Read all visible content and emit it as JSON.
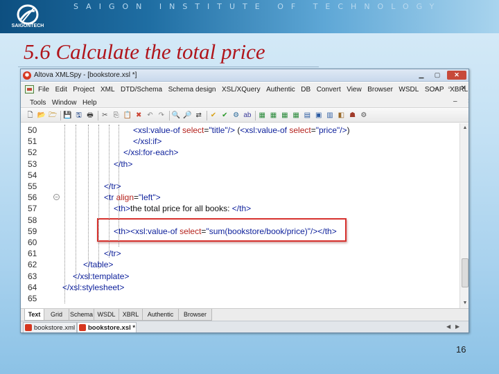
{
  "slide": {
    "institute": "SAIGON INSTITUTE OF TECHNOLOGY",
    "logo_text": "SAIGONTECH",
    "title": "5.6 Calculate the total price",
    "page_number": "16"
  },
  "window": {
    "title": "Altova XMLSpy - [bookstore.xsl *]",
    "min_icon": "▁",
    "max_icon": "▢",
    "close_icon": "✕"
  },
  "menu": {
    "row1": [
      "File",
      "Edit",
      "Project",
      "XML",
      "DTD/Schema",
      "Schema design",
      "XSL/XQuery",
      "Authentic",
      "DB",
      "Convert",
      "View",
      "Browser",
      "WSDL",
      "SOAP",
      "XBRL"
    ],
    "row2": [
      "Tools",
      "Window",
      "Help"
    ],
    "doc_controls": "–  ▫  ✕",
    "doc_controls2": "–  ✕"
  },
  "toolbar": {
    "buttons": [
      "new-icon",
      "open-icon",
      "open-folder-icon",
      "save-icon",
      "save-all-icon",
      "print-icon",
      "cut-icon",
      "copy-icon",
      "paste-icon",
      "delete-icon",
      "undo-icon",
      "redo-icon",
      "find-icon",
      "find-next-icon",
      "replace-icon",
      "wellformed-icon",
      "validate-icon",
      "xslt-icon",
      "spell-icon",
      "grid-icon-1",
      "grid-icon-2",
      "grid-icon-3",
      "grid-icon-4",
      "view-icon-1",
      "view-icon-2",
      "view-icon-3",
      "chart-icon",
      "debug-icon",
      "settings-icon"
    ]
  },
  "editor": {
    "lines": [
      {
        "no": "50",
        "indent": 191,
        "parts": [
          [
            "c-tag",
            "<xsl:value-of "
          ],
          [
            "c-attr",
            "select"
          ],
          [
            "c-plain",
            "="
          ],
          [
            "c-val",
            "\"title\""
          ],
          [
            "c-tag",
            "/> "
          ],
          [
            "c-plain",
            "("
          ],
          [
            "c-tag",
            "<xsl:value-of "
          ],
          [
            "c-attr",
            "select"
          ],
          [
            "c-plain",
            "="
          ],
          [
            "c-val",
            "\"price\""
          ],
          [
            "c-tag",
            "/>"
          ],
          [
            "c-plain",
            ")"
          ]
        ]
      },
      {
        "no": "51",
        "indent": 191,
        "parts": [
          [
            "c-tag",
            "</xsl:if>"
          ]
        ]
      },
      {
        "no": "52",
        "indent": 177,
        "parts": [
          [
            "c-tag",
            "</xsl:for-each>"
          ]
        ]
      },
      {
        "no": "53",
        "indent": 163,
        "parts": [
          [
            "c-tag",
            "</th>"
          ]
        ]
      },
      {
        "no": "54",
        "indent": 0,
        "parts": []
      },
      {
        "no": "55",
        "indent": 149,
        "parts": [
          [
            "c-tag",
            "</tr>"
          ]
        ]
      },
      {
        "no": "56",
        "indent": 149,
        "parts": [
          [
            "c-tag",
            "<tr "
          ],
          [
            "c-attr",
            "align"
          ],
          [
            "c-plain",
            "="
          ],
          [
            "c-val",
            "\"left\""
          ],
          [
            "c-tag",
            ">"
          ]
        ]
      },
      {
        "no": "57",
        "indent": 163,
        "parts": [
          [
            "c-tag",
            "<th>"
          ],
          [
            "c-plain",
            "the total price for all books: "
          ],
          [
            "c-tag",
            "</th>"
          ]
        ]
      },
      {
        "no": "58",
        "indent": 0,
        "parts": []
      },
      {
        "no": "59",
        "indent": 163,
        "parts": [
          [
            "c-tag",
            "<th><xsl:value-of "
          ],
          [
            "c-attr",
            "select"
          ],
          [
            "c-plain",
            "="
          ],
          [
            "c-val",
            "\"sum(bookstore/book/price)\""
          ],
          [
            "c-tag",
            "/></th>"
          ]
        ]
      },
      {
        "no": "60",
        "indent": 0,
        "parts": []
      },
      {
        "no": "61",
        "indent": 149,
        "parts": [
          [
            "c-tag",
            "</tr>"
          ]
        ]
      },
      {
        "no": "62",
        "indent": 119,
        "parts": [
          [
            "c-tag",
            "</table>"
          ]
        ]
      },
      {
        "no": "63",
        "indent": 104,
        "parts": [
          [
            "c-tag",
            "</xsl:template>"
          ]
        ]
      },
      {
        "no": "64",
        "indent": 89,
        "parts": [
          [
            "c-tag",
            "</xsl:stylesheet>"
          ]
        ]
      },
      {
        "no": "65",
        "indent": 0,
        "parts": []
      }
    ]
  },
  "view_tabs": [
    "Text",
    "Grid",
    "Schema",
    "WSDL",
    "XBRL",
    "Authentic",
    "Browser"
  ],
  "active_view_tab": "Text",
  "doc_tabs": [
    {
      "label": "bookstore.xml",
      "active": false
    },
    {
      "label": "bookstore.xsl *",
      "active": true
    }
  ],
  "colors": {
    "title_red": "#b0151b",
    "highlight_red": "#d7312d",
    "tag_blue": "#0b1e9a",
    "attr_red": "#b5221d"
  }
}
